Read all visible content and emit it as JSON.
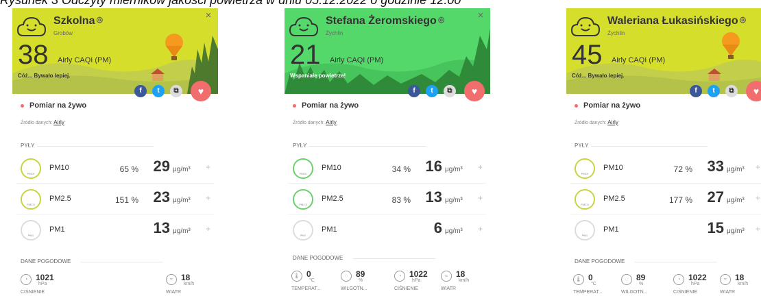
{
  "caption": "Rysunek 3 Odczyty mierników jakości powietrza w dniu 05.12.2022 o godzinie 12:00",
  "cards": [
    {
      "station": "Szkolna",
      "city": "Grobów",
      "aqi": "38",
      "aqi_label": "Airly CAQI (PM)",
      "message": "Cóż... Bywało lepiej.",
      "header_color": "#d6de2c",
      "live": "Pomiar na żywo",
      "source_prefix": "Źródło danych:",
      "source_link": "Airly",
      "pm_section": "PYŁY",
      "pm": [
        {
          "name": "PM10",
          "pct": "65 %",
          "value": "29",
          "unit": "μg/m³",
          "plus": "+",
          "circle": "PM10"
        },
        {
          "name": "PM2.5",
          "pct": "151 %",
          "value": "23",
          "unit": "μg/m³",
          "plus": "+",
          "circle": "PM2.5"
        },
        {
          "name": "PM1",
          "pct": "",
          "value": "13",
          "unit": "μg/m³",
          "plus": "+",
          "circle": "PM1"
        }
      ],
      "weather_section": "DANE POGODOWE",
      "weather": [
        {
          "value": "1021",
          "unit": "hPa",
          "label": "CIŚNIENIE",
          "icon": "gauge-icon"
        },
        {
          "value": "18",
          "unit": "km/h",
          "label": "WIATR",
          "icon": "wind-icon"
        }
      ]
    },
    {
      "station": "Stefana Żeromskiego",
      "city": "Żychlin",
      "aqi": "21",
      "aqi_label": "Airly CAQI (PM)",
      "message": "Wspaniałe powietrze!",
      "header_color": "#55d86a",
      "live": "Pomiar na żywo",
      "source_prefix": "Źródło danych:",
      "source_link": "Airly",
      "pm_section": "PYŁY",
      "pm": [
        {
          "name": "PM10",
          "pct": "34 %",
          "value": "16",
          "unit": "μg/m³",
          "plus": "+",
          "circle": "PM10"
        },
        {
          "name": "PM2.5",
          "pct": "83 %",
          "value": "13",
          "unit": "μg/m³",
          "plus": "+",
          "circle": "PM2.5"
        },
        {
          "name": "PM1",
          "pct": "",
          "value": "6",
          "unit": "μg/m³",
          "plus": "+",
          "circle": "PM1"
        }
      ],
      "weather_section": "DANE POGODOWE",
      "weather": [
        {
          "value": "0",
          "unit": "°C",
          "label": "TEMPERAT...",
          "icon": "thermometer-icon"
        },
        {
          "value": "89",
          "unit": "%",
          "label": "WILGOTN...",
          "icon": "humidity-icon"
        },
        {
          "value": "1022",
          "unit": "hPa",
          "label": "CIŚNIENIE",
          "icon": "gauge-icon"
        },
        {
          "value": "18",
          "unit": "km/h",
          "label": "WIATR",
          "icon": "wind-icon"
        }
      ]
    },
    {
      "station": "Waleriana Łukasińskiego",
      "city": "Żychlin",
      "aqi": "45",
      "aqi_label": "Airly CAQI (PM)",
      "message": "Cóż... Bywało lepiej.",
      "header_color": "#d6de2c",
      "live": "Pomiar na żywo",
      "source_prefix": "Źródło danych:",
      "source_link": "Airly",
      "pm_section": "PYŁY",
      "pm": [
        {
          "name": "PM10",
          "pct": "72 %",
          "value": "33",
          "unit": "μg/m³",
          "plus": "+",
          "circle": "PM10"
        },
        {
          "name": "PM2.5",
          "pct": "177 %",
          "value": "27",
          "unit": "μg/m³",
          "plus": "+",
          "circle": "PM2.5"
        },
        {
          "name": "PM1",
          "pct": "",
          "value": "15",
          "unit": "μg/m³",
          "plus": "+",
          "circle": "PM1"
        }
      ],
      "weather_section": "DANE POGODOWE",
      "weather": [
        {
          "value": "0",
          "unit": "°C",
          "label": "TEMPERAT...",
          "icon": "thermometer-icon"
        },
        {
          "value": "89",
          "unit": "%",
          "label": "WILGOTN...",
          "icon": "humidity-icon"
        },
        {
          "value": "1022",
          "unit": "hPa",
          "label": "CIŚNIENIE",
          "icon": "gauge-icon"
        },
        {
          "value": "18",
          "unit": "km/h",
          "label": "WIATR",
          "icon": "wind-icon"
        }
      ]
    }
  ],
  "share": {
    "facebook": "f",
    "twitter": "t",
    "copy": "⧉",
    "close": "×",
    "favorite": "♥",
    "location_dot": "◎"
  }
}
